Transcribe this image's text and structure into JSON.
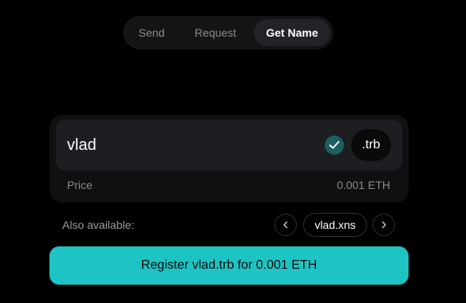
{
  "tabs": [
    {
      "label": "Send",
      "active": false
    },
    {
      "label": "Request",
      "active": false
    },
    {
      "label": "Get Name",
      "active": true
    }
  ],
  "name_input": {
    "value": "vlad",
    "available": true
  },
  "tld": {
    "label": ".trb"
  },
  "price": {
    "label": "Price",
    "value": "0.001 ETH"
  },
  "also_available": {
    "label": "Also available:",
    "items": [
      "vlad.xns"
    ]
  },
  "register_button": {
    "label": "Register vlad.trb for 0.001 ETH"
  },
  "colors": {
    "background": "#000000",
    "accent": "#1ec3c3",
    "check_bg": "#1e5f61",
    "muted_text": "#8a8b90"
  },
  "icons": {
    "available": "check-icon",
    "prev": "chevron-left-icon",
    "next": "chevron-right-icon"
  }
}
